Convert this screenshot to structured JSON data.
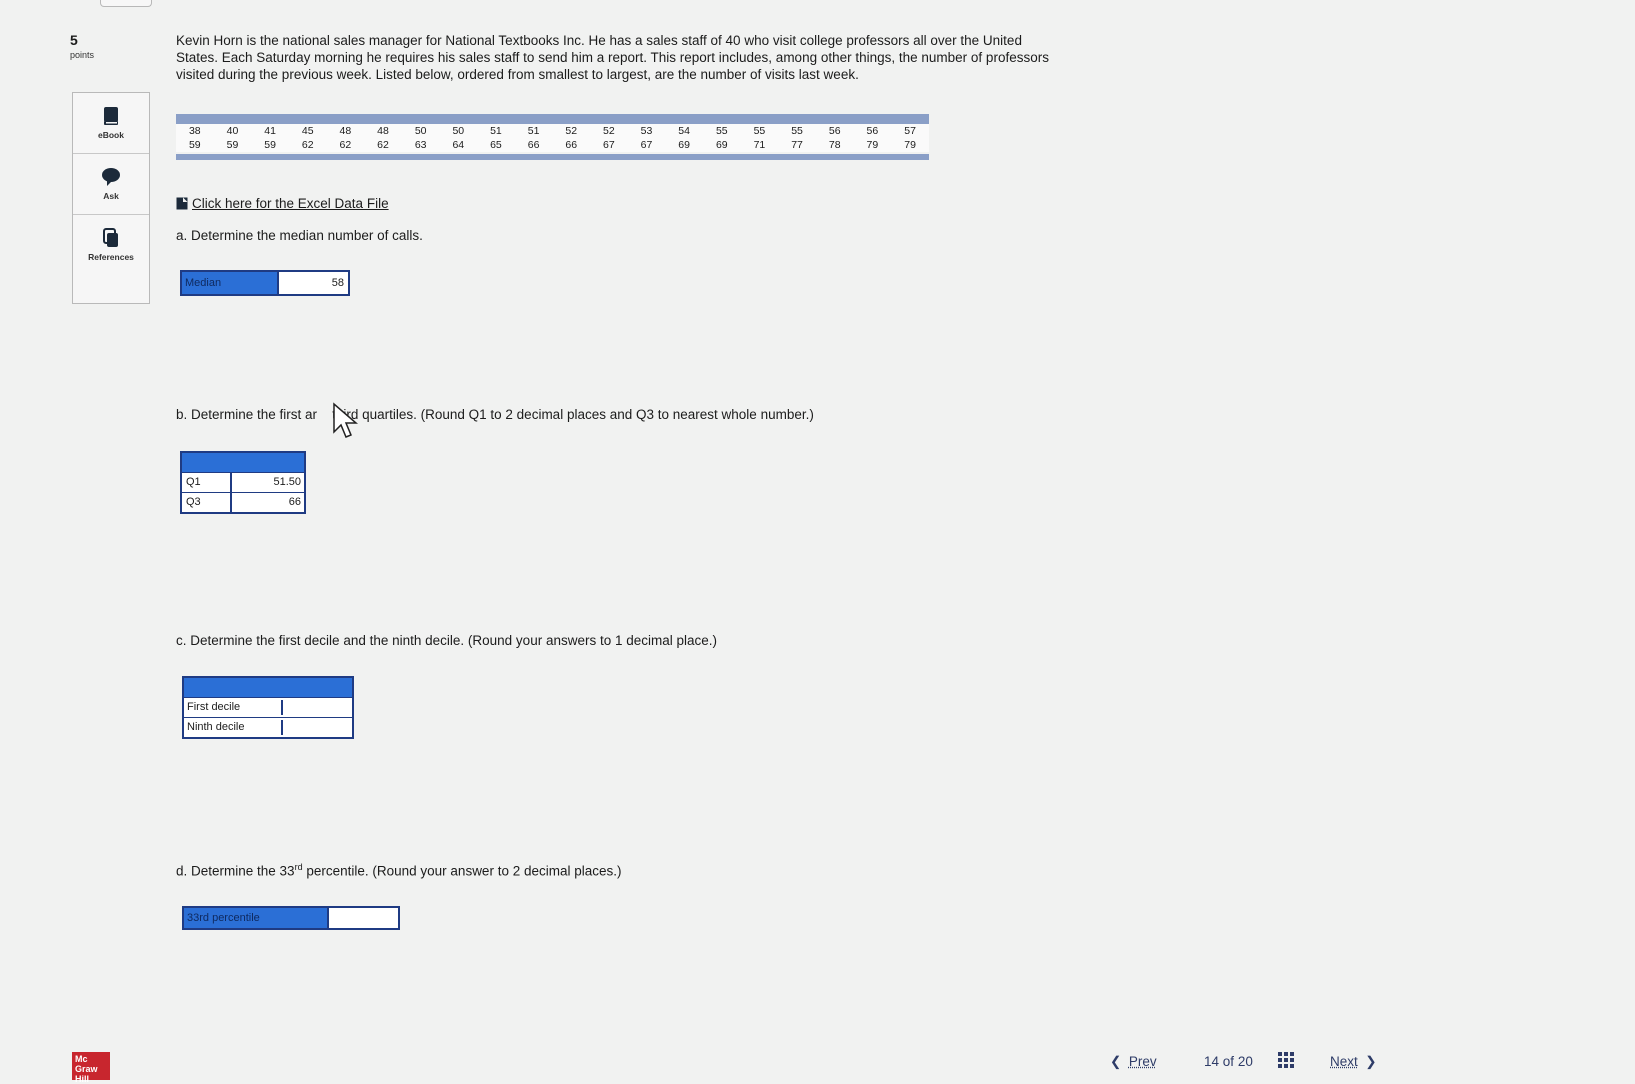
{
  "question": {
    "number": "5",
    "points_label": "points",
    "text": "Kevin Horn is the national sales manager for National Textbooks Inc. He has a sales staff of 40 who visit college professors all over the United States. Each Saturday morning he requires his sales staff to send him a report. This report includes, among other things, the number of professors visited during the previous week. Listed below, ordered from smallest to largest, are the number of visits last week."
  },
  "sidebar": {
    "items": [
      {
        "label": "eBook",
        "icon": "book-icon"
      },
      {
        "label": "Ask",
        "icon": "speech-bubble-icon"
      },
      {
        "label": "References",
        "icon": "documents-icon"
      }
    ]
  },
  "data_rows": [
    [
      "38",
      "40",
      "41",
      "45",
      "48",
      "48",
      "50",
      "50",
      "51",
      "51",
      "52",
      "52",
      "53",
      "54",
      "55",
      "55",
      "55",
      "56",
      "56",
      "57"
    ],
    [
      "59",
      "59",
      "59",
      "62",
      "62",
      "62",
      "63",
      "64",
      "65",
      "66",
      "66",
      "67",
      "67",
      "69",
      "69",
      "71",
      "77",
      "78",
      "79",
      "79"
    ]
  ],
  "excel_link": "Click here for the Excel Data File",
  "part_a": {
    "prompt": "a. Determine the median number of calls.",
    "label": "Median",
    "value": "58"
  },
  "part_b": {
    "prompt_start": "b. Determine the first ar",
    "prompt_end": "third quartiles. (Round Q1 to 2 decimal places and Q3 to nearest whole number.)",
    "rows": [
      {
        "label": "Q1",
        "value": "51.50"
      },
      {
        "label": "Q3",
        "value": "66"
      }
    ]
  },
  "part_c": {
    "prompt": "c. Determine the first decile and the ninth decile. (Round your answers to 1 decimal place.)",
    "rows": [
      {
        "label": "First decile",
        "value": ""
      },
      {
        "label": "Ninth decile",
        "value": ""
      }
    ]
  },
  "part_d": {
    "prompt_start": "d. Determine the 33",
    "prompt_sup": "rd",
    "prompt_end": " percentile. (Round your answer to 2 decimal places.)",
    "label": "33rd percentile",
    "value": ""
  },
  "footer": {
    "logo": "Mc Graw Hill",
    "prev": "Prev",
    "page_current": "14",
    "page_of": "of",
    "page_total": "20",
    "next": "Next"
  },
  "colors": {
    "accent_blue": "#2b6fd6",
    "border_navy": "#1f3b83",
    "data_header": "#8a9fc7",
    "logo_red": "#c8262e"
  }
}
